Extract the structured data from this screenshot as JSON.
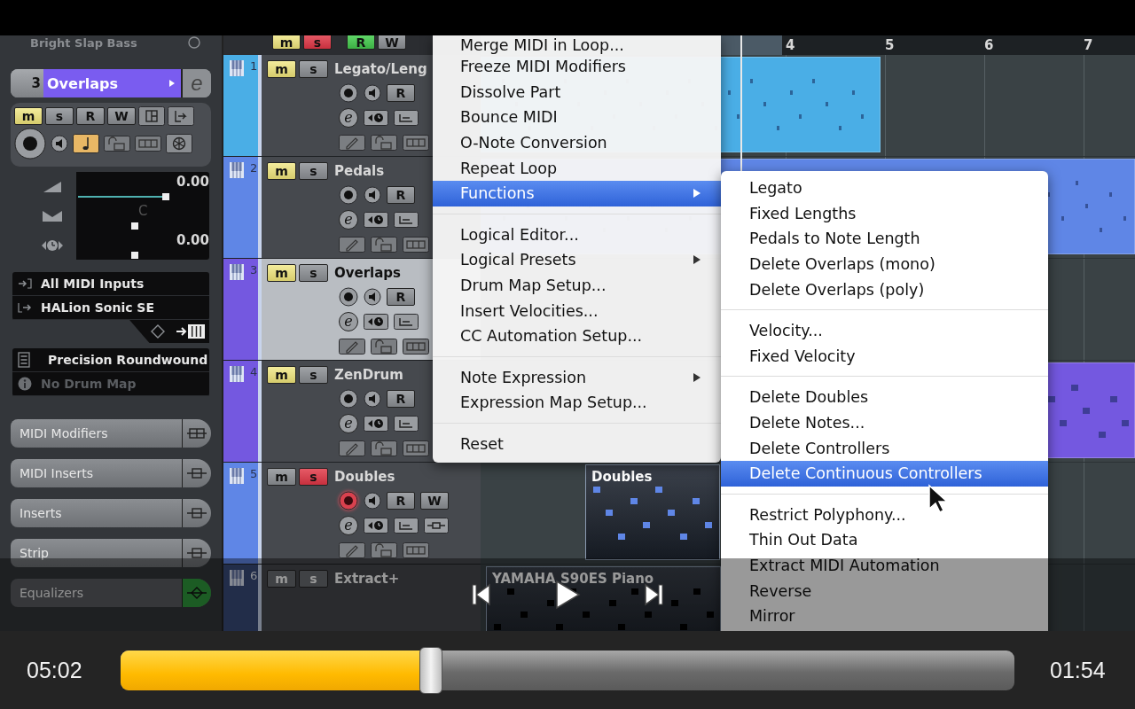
{
  "inspector": {
    "top_track": "Bright Slap Bass",
    "track_number": "3",
    "track_name": "Overlaps",
    "edit_label": "e",
    "buttons": [
      {
        "label": "m",
        "kind": "mute",
        "on": true
      },
      {
        "label": "s",
        "kind": "solo",
        "on": false
      },
      {
        "label": "R",
        "kind": "read",
        "on": false
      },
      {
        "label": "W",
        "kind": "write",
        "on": false
      }
    ],
    "musical_mode": true,
    "volume": {
      "reading": "0.00",
      "level": 0.77
    },
    "pan": {
      "reading": "C",
      "level": 0.5
    },
    "delay": {
      "reading": "0.00",
      "level": 0.5
    },
    "input": "All MIDI Inputs",
    "output": "HALion Sonic SE",
    "preset": "Precision Roundwound",
    "drum_map": "No Drum Map",
    "sections": [
      {
        "label": "MIDI Modifiers",
        "kind": "modifiers"
      },
      {
        "label": "MIDI Inserts",
        "kind": "inserts"
      },
      {
        "label": "Inserts",
        "kind": "inserts"
      },
      {
        "label": "Strip",
        "kind": "inserts"
      },
      {
        "label": "Equalizers",
        "kind": "eq"
      }
    ]
  },
  "header_buttons": [
    {
      "label": "m",
      "kind": "mute"
    },
    {
      "label": "s",
      "kind": "solo"
    },
    {
      "label": "R",
      "kind": "read"
    },
    {
      "label": "W",
      "kind": "write"
    }
  ],
  "tracks": [
    {
      "number": "1",
      "name": "Legato/Leng",
      "color": "#4aaee6",
      "selected": false,
      "mute": {
        "label": "m",
        "on": true
      },
      "solo": {
        "label": "s",
        "on": false
      },
      "record": false,
      "edit_label": "e",
      "rw": [
        "R"
      ]
    },
    {
      "number": "2",
      "name": "Pedals",
      "color": "#5f86e6",
      "selected": false,
      "mute": {
        "label": "m",
        "on": true
      },
      "solo": {
        "label": "s",
        "on": false
      },
      "record": false,
      "edit_label": "e",
      "rw": [
        "R"
      ]
    },
    {
      "number": "3",
      "name": "Overlaps",
      "color": "#7458e0",
      "selected": true,
      "mute": {
        "label": "m",
        "on": true
      },
      "solo": {
        "label": "s",
        "on": false
      },
      "record": false,
      "edit_label": "e",
      "rw": [
        "R"
      ]
    },
    {
      "number": "4",
      "name": "ZenDrum",
      "color": "#7458e0",
      "selected": false,
      "mute": {
        "label": "m",
        "on": true
      },
      "solo": {
        "label": "s",
        "on": false
      },
      "record": false,
      "edit_label": "e",
      "rw": [
        "R"
      ]
    },
    {
      "number": "5",
      "name": "Doubles",
      "color": "#5f86e6",
      "selected": false,
      "mute": {
        "label": "m",
        "on": false
      },
      "solo": {
        "label": "s",
        "on": true
      },
      "record": true,
      "edit_label": "e",
      "rw": [
        "R",
        "W"
      ],
      "part_name": "Doubles"
    },
    {
      "number": "6",
      "name": "Extract+",
      "selected": false,
      "mute": {
        "label": "m",
        "on": false
      },
      "solo": {
        "label": "s",
        "on": false
      },
      "part_name": "YAMAHA S90ES Piano"
    }
  ],
  "ruler": [
    "4",
    "5",
    "6",
    "7"
  ],
  "context_menu": {
    "items": [
      {
        "kind": "item",
        "label": "Merge MIDI in Loop...",
        "selected": false,
        "submenu": false
      },
      {
        "kind": "item",
        "label": "Freeze MIDI Modifiers",
        "selected": false,
        "submenu": false
      },
      {
        "kind": "item",
        "label": "Dissolve Part",
        "selected": false,
        "submenu": false
      },
      {
        "kind": "item",
        "label": "Bounce MIDI",
        "selected": false,
        "submenu": false
      },
      {
        "kind": "item",
        "label": "O-Note Conversion",
        "selected": false,
        "submenu": false
      },
      {
        "kind": "item",
        "label": "Repeat Loop",
        "selected": false,
        "submenu": false
      },
      {
        "kind": "item",
        "label": "Functions",
        "selected": true,
        "submenu": true
      },
      {
        "kind": "separator"
      },
      {
        "kind": "item",
        "label": "Logical Editor...",
        "selected": false,
        "submenu": false
      },
      {
        "kind": "item",
        "label": "Logical Presets",
        "selected": false,
        "submenu": true
      },
      {
        "kind": "item",
        "label": "Drum Map Setup...",
        "selected": false,
        "submenu": false
      },
      {
        "kind": "item",
        "label": "Insert Velocities...",
        "selected": false,
        "submenu": false
      },
      {
        "kind": "item",
        "label": "CC Automation Setup...",
        "selected": false,
        "submenu": false
      },
      {
        "kind": "separator"
      },
      {
        "kind": "item",
        "label": "Note Expression",
        "selected": false,
        "submenu": true
      },
      {
        "kind": "item",
        "label": "Expression Map Setup...",
        "selected": false,
        "submenu": false
      },
      {
        "kind": "separator"
      },
      {
        "kind": "item",
        "label": "Reset",
        "selected": false,
        "submenu": false
      }
    ]
  },
  "submenu": {
    "items": [
      {
        "kind": "item",
        "label": "Legato",
        "selected": false
      },
      {
        "kind": "item",
        "label": "Fixed Lengths",
        "selected": false
      },
      {
        "kind": "item",
        "label": "Pedals to Note Length",
        "selected": false
      },
      {
        "kind": "item",
        "label": "Delete Overlaps (mono)",
        "selected": false
      },
      {
        "kind": "item",
        "label": "Delete Overlaps (poly)",
        "selected": false
      },
      {
        "kind": "separator"
      },
      {
        "kind": "item",
        "label": "Velocity...",
        "selected": false
      },
      {
        "kind": "item",
        "label": "Fixed Velocity",
        "selected": false
      },
      {
        "kind": "separator"
      },
      {
        "kind": "item",
        "label": "Delete Doubles",
        "selected": false
      },
      {
        "kind": "item",
        "label": "Delete Notes...",
        "selected": false
      },
      {
        "kind": "item",
        "label": "Delete Controllers",
        "selected": false
      },
      {
        "kind": "item",
        "label": "Delete Continuous Controllers",
        "selected": true
      },
      {
        "kind": "separator"
      },
      {
        "kind": "item",
        "label": "Restrict Polyphony...",
        "selected": false
      },
      {
        "kind": "item",
        "label": "Thin Out Data",
        "selected": false
      },
      {
        "kind": "item",
        "label": "Extract MIDI Automation",
        "selected": false
      },
      {
        "kind": "item",
        "label": "Reverse",
        "selected": false
      },
      {
        "kind": "item",
        "label": "Mirror",
        "selected": false
      }
    ]
  },
  "player": {
    "elapsed": "05:02",
    "remaining": "01:54",
    "level": 0.347
  }
}
